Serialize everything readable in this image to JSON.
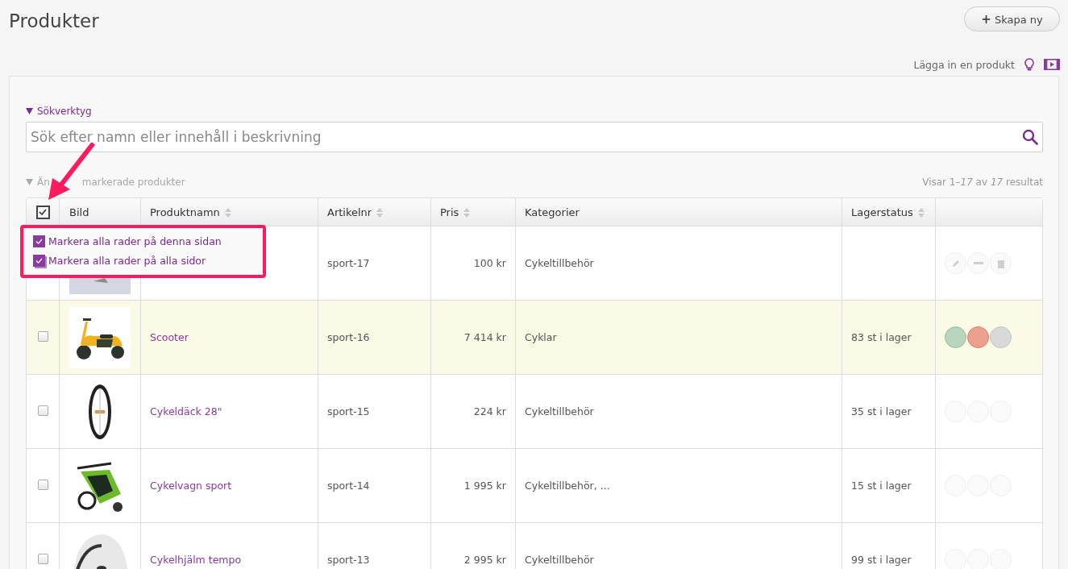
{
  "page": {
    "title": "Produkter"
  },
  "create_button": {
    "label": "Skapa ny",
    "icon": "+"
  },
  "help": {
    "label": "Lägga in en produkt"
  },
  "search_tools": {
    "label": "Sökverktyg",
    "expanded": true
  },
  "search": {
    "placeholder": "Sök efter namn eller innehåll i beskrivning"
  },
  "bulk_actions": {
    "label_parts": [
      "Än",
      "markerade produkter"
    ],
    "disabled": true
  },
  "result_count": {
    "parts": [
      "Visar 1",
      "–",
      "17",
      " av ",
      "17",
      " resultat"
    ]
  },
  "select_all": {
    "checked": true
  },
  "columns": [
    {
      "label": "Bild",
      "sortable": false
    },
    {
      "label": "Produktnamn",
      "sortable": true
    },
    {
      "label": "Artikelnr",
      "sortable": true
    },
    {
      "label": "Pris",
      "sortable": true
    },
    {
      "label": "Kategorier",
      "sortable": false
    },
    {
      "label": "Lagerstatus",
      "sortable": true
    }
  ],
  "select_menu": {
    "options": [
      {
        "label": "Markera alla rader på denna sidan",
        "kind": "page"
      },
      {
        "label": "Markera alla rader på alla sidor",
        "kind": "all"
      }
    ]
  },
  "rows": [
    {
      "article": "sport-17",
      "price": "100 kr",
      "categories": "Cykeltillbehör",
      "highlighted": false,
      "actions_colored": false,
      "action_icons": true
    },
    {
      "checked": false,
      "name": "Scooter",
      "article": "sport-16",
      "price": "7 414 kr",
      "categories": "Cyklar",
      "stock": "83 st i lager",
      "highlighted": true,
      "actions_colored": true,
      "action_icons": false
    },
    {
      "checked": false,
      "name": "Cykeldäck 28\"",
      "article": "sport-15",
      "price": "224 kr",
      "categories": "Cykeltillbehör",
      "stock": "35 st i lager",
      "highlighted": false,
      "actions_colored": false,
      "action_icons": false
    },
    {
      "checked": false,
      "name": "Cykelvagn sport",
      "article": "sport-14",
      "price": "1 995 kr",
      "categories": "Cykeltillbehör, ...",
      "stock": "15 st i lager",
      "highlighted": false,
      "actions_colored": false,
      "action_icons": false
    },
    {
      "checked": false,
      "name": "Cykelhjälm tempo",
      "article": "sport-13",
      "price": "2 995 kr",
      "categories": "Cykeltillbehör",
      "stock": "99 st i lager",
      "highlighted": false,
      "actions_colored": false,
      "action_icons": false
    }
  ]
}
